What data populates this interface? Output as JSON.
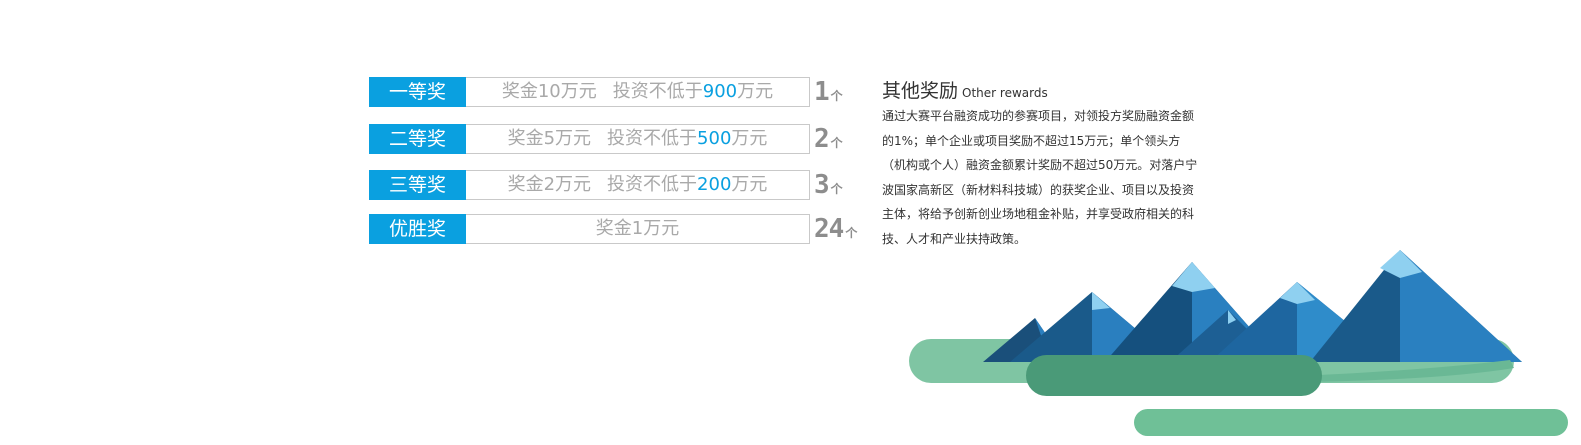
{
  "prizes": [
    {
      "label": "一等奖",
      "text_before": "奖金10万元",
      "text_invest": "投资不低于",
      "amount": "900",
      "text_after": "万元",
      "count": "1",
      "unit": "个"
    },
    {
      "label": "二等奖",
      "text_before": "奖金5万元",
      "text_invest": "投资不低于",
      "amount": "500",
      "text_after": "万元",
      "count": "2",
      "unit": "个"
    },
    {
      "label": "三等奖",
      "text_before": "奖金2万元",
      "text_invest": "投资不低于",
      "amount": "200",
      "text_after": "万元",
      "count": "3",
      "unit": "个"
    },
    {
      "label": "优胜奖",
      "text_before": "奖金1万元",
      "count": "24",
      "unit": "个"
    }
  ],
  "other_rewards": {
    "title_cn": "其他奖励",
    "title_en": "Other rewards",
    "body": "通过大赛平台融资成功的参赛项目，对领投方奖励融资金额的1%；单个企业或项目奖励不超过15万元；单个领头方（机构或个人）融资金额累计奖励不超过50万元。对落户宁波国家高新区（新材料科技城）的获奖企业、项目以及投资主体，将给予创新创业场地租金补贴，并享受政府相关的科技、人才和产业扶持政策。"
  },
  "colors": {
    "accent": "#0aa0e0",
    "text_gray": "#a9a9a9",
    "mountain_dark": "#1a4f7a",
    "mountain_mid": "#2a7fbf",
    "mountain_light": "#8fd0f0",
    "green_light": "#7fc5a3",
    "green_dark": "#4a9a78"
  }
}
